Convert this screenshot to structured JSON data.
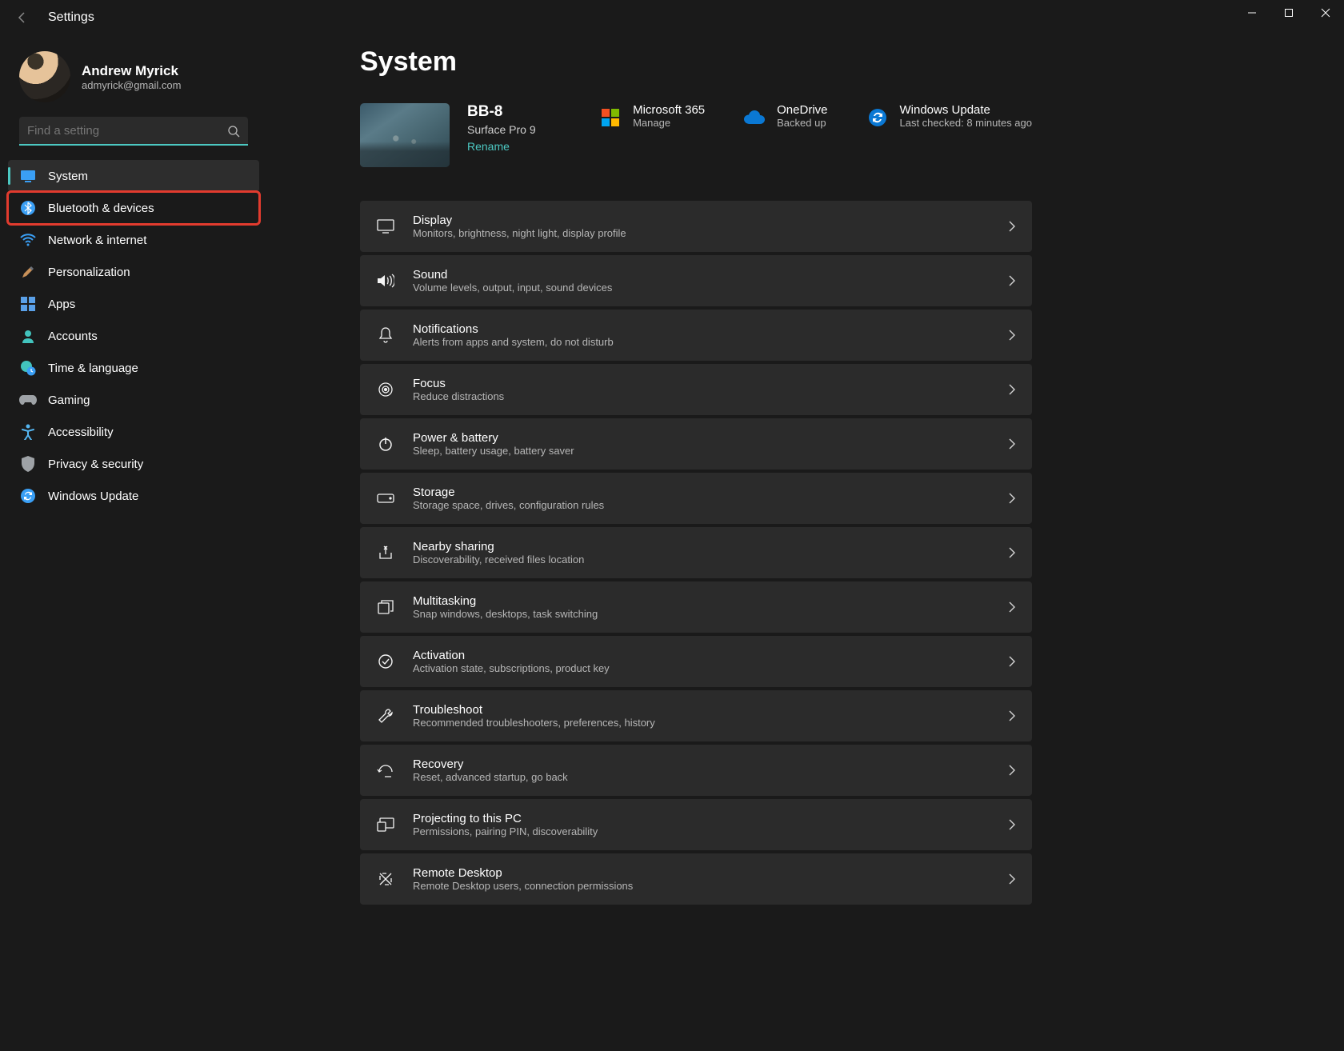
{
  "window": {
    "title": "Settings"
  },
  "user": {
    "name": "Andrew Myrick",
    "email": "admyrick@gmail.com"
  },
  "search": {
    "placeholder": "Find a setting"
  },
  "nav": {
    "items": [
      {
        "label": "System"
      },
      {
        "label": "Bluetooth & devices"
      },
      {
        "label": "Network & internet"
      },
      {
        "label": "Personalization"
      },
      {
        "label": "Apps"
      },
      {
        "label": "Accounts"
      },
      {
        "label": "Time & language"
      },
      {
        "label": "Gaming"
      },
      {
        "label": "Accessibility"
      },
      {
        "label": "Privacy & security"
      },
      {
        "label": "Windows Update"
      }
    ]
  },
  "page": {
    "title": "System"
  },
  "device": {
    "name": "BB-8",
    "model": "Surface Pro 9",
    "rename": "Rename"
  },
  "status": {
    "m365": {
      "title": "Microsoft 365",
      "sub": "Manage"
    },
    "onedrive": {
      "title": "OneDrive",
      "sub": "Backed up"
    },
    "update": {
      "title": "Windows Update",
      "sub": "Last checked: 8 minutes ago"
    }
  },
  "cards": [
    {
      "title": "Display",
      "sub": "Monitors, brightness, night light, display profile"
    },
    {
      "title": "Sound",
      "sub": "Volume levels, output, input, sound devices"
    },
    {
      "title": "Notifications",
      "sub": "Alerts from apps and system, do not disturb"
    },
    {
      "title": "Focus",
      "sub": "Reduce distractions"
    },
    {
      "title": "Power & battery",
      "sub": "Sleep, battery usage, battery saver"
    },
    {
      "title": "Storage",
      "sub": "Storage space, drives, configuration rules"
    },
    {
      "title": "Nearby sharing",
      "sub": "Discoverability, received files location"
    },
    {
      "title": "Multitasking",
      "sub": "Snap windows, desktops, task switching"
    },
    {
      "title": "Activation",
      "sub": "Activation state, subscriptions, product key"
    },
    {
      "title": "Troubleshoot",
      "sub": "Recommended troubleshooters, preferences, history"
    },
    {
      "title": "Recovery",
      "sub": "Reset, advanced startup, go back"
    },
    {
      "title": "Projecting to this PC",
      "sub": "Permissions, pairing PIN, discoverability"
    },
    {
      "title": "Remote Desktop",
      "sub": "Remote Desktop users, connection permissions"
    }
  ]
}
